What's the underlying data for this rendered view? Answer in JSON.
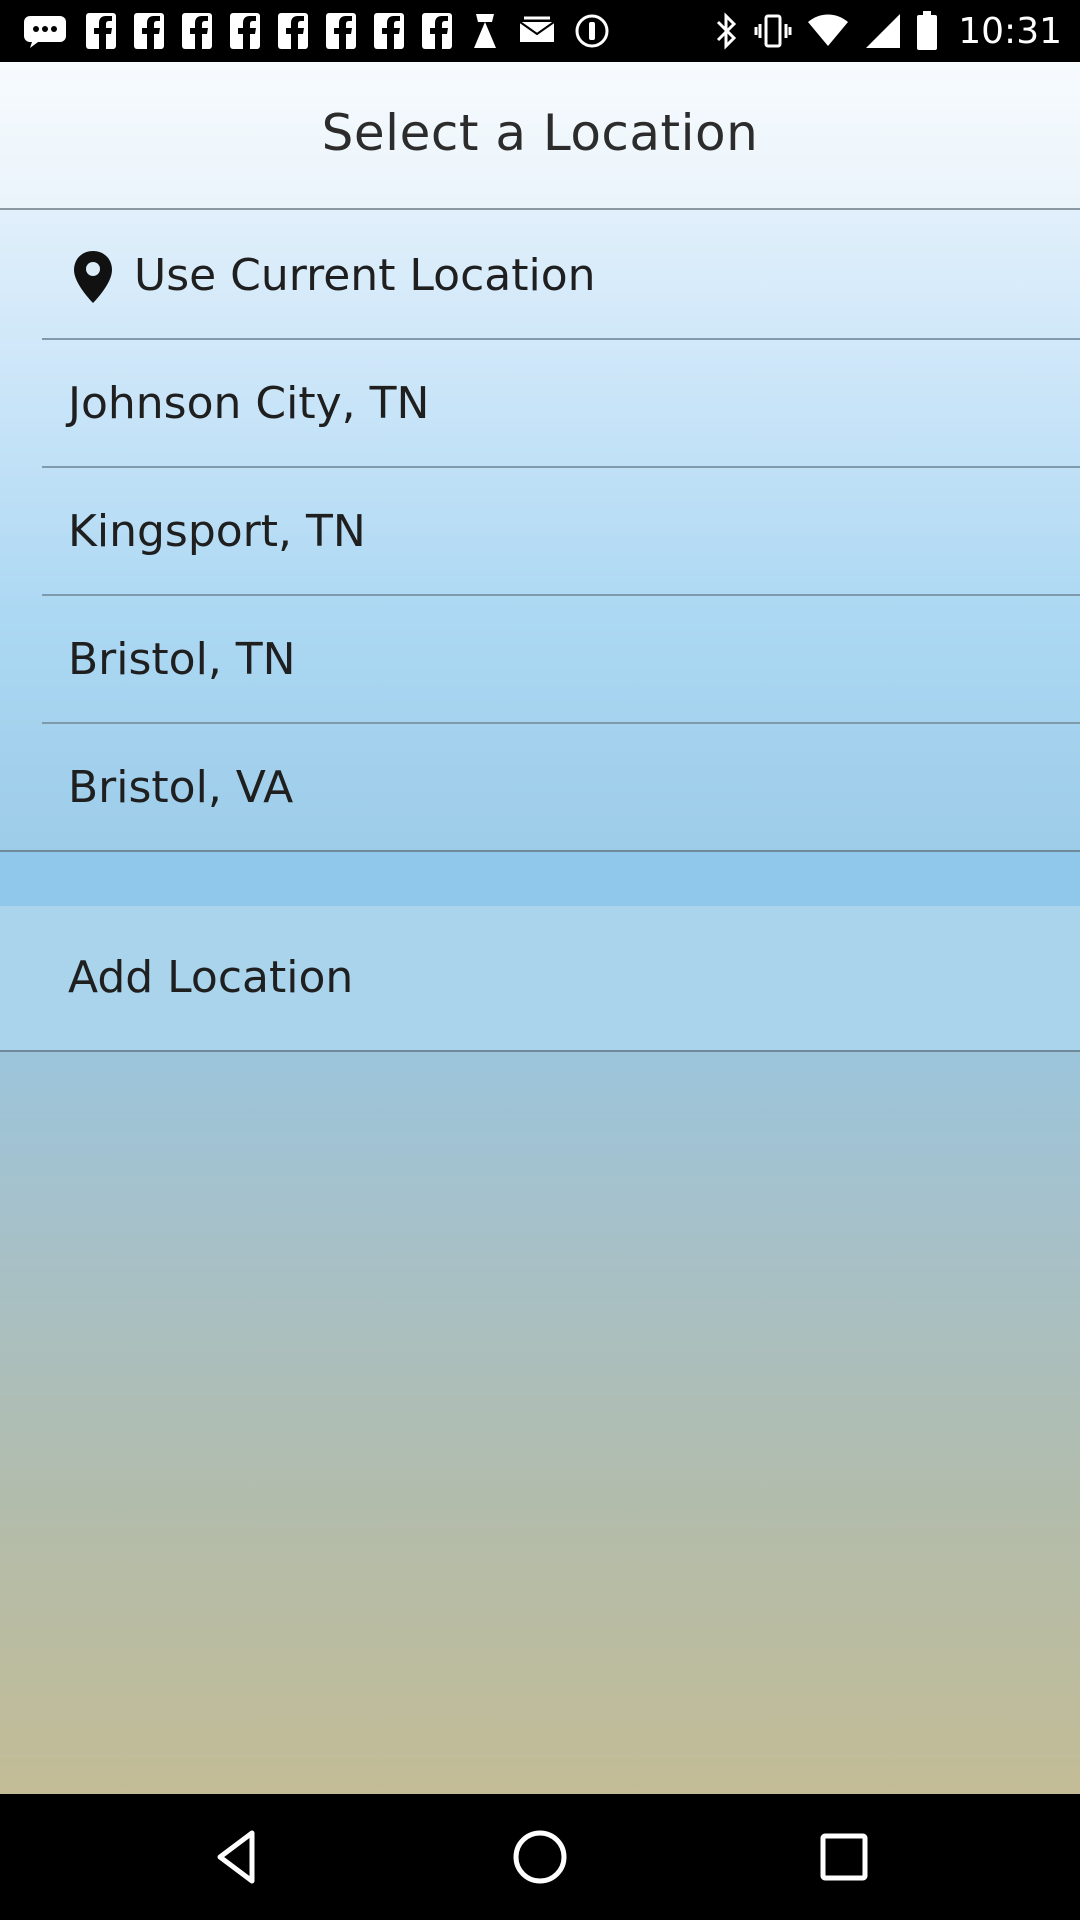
{
  "status_bar": {
    "time": "10:31",
    "left_icons": [
      "message-icon",
      "facebook-icon",
      "facebook-icon",
      "facebook-icon",
      "facebook-icon",
      "facebook-icon",
      "facebook-icon",
      "facebook-icon",
      "app-icon",
      "email-icon",
      "info-icon"
    ],
    "right_icons": [
      "bluetooth-icon",
      "vibrate-icon",
      "wifi-icon",
      "signal-icon",
      "battery-icon"
    ]
  },
  "header": {
    "title": "Select a Location"
  },
  "locations": {
    "current": {
      "icon": "location-pin-icon",
      "label": "Use Current Location"
    },
    "items": [
      {
        "label": "Johnson City, TN"
      },
      {
        "label": "Kingsport, TN"
      },
      {
        "label": "Bristol, TN"
      },
      {
        "label": "Bristol, VA"
      }
    ]
  },
  "add_location": {
    "label": "Add Location"
  },
  "nav": {
    "icons": [
      "back-icon",
      "home-icon",
      "recents-icon"
    ]
  }
}
